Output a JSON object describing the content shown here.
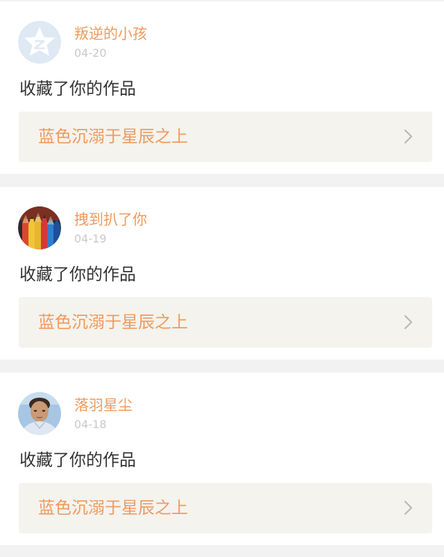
{
  "feed": {
    "items": [
      {
        "username": "叛逆的小孩",
        "date": "04-20",
        "action": "收藏了你的作品",
        "work_title": "蓝色沉溺于星辰之上",
        "avatar_icon": "qq-zone-default-avatar-icon"
      },
      {
        "username": "拽到扒了你",
        "date": "04-19",
        "action": "收藏了你的作品",
        "work_title": "蓝色沉溺于星辰之上",
        "avatar_icon": "colored-pencils-avatar"
      },
      {
        "username": "落羽星尘",
        "date": "04-18",
        "action": "收藏了你的作品",
        "work_title": "蓝色沉溺于星辰之上",
        "avatar_icon": "person-photo-avatar"
      }
    ]
  },
  "colors": {
    "accent": "#ef9a5d",
    "link_bg": "#f4f3ee",
    "date": "#c9c9c9",
    "text": "#333333",
    "background": "#f2f2f2"
  }
}
